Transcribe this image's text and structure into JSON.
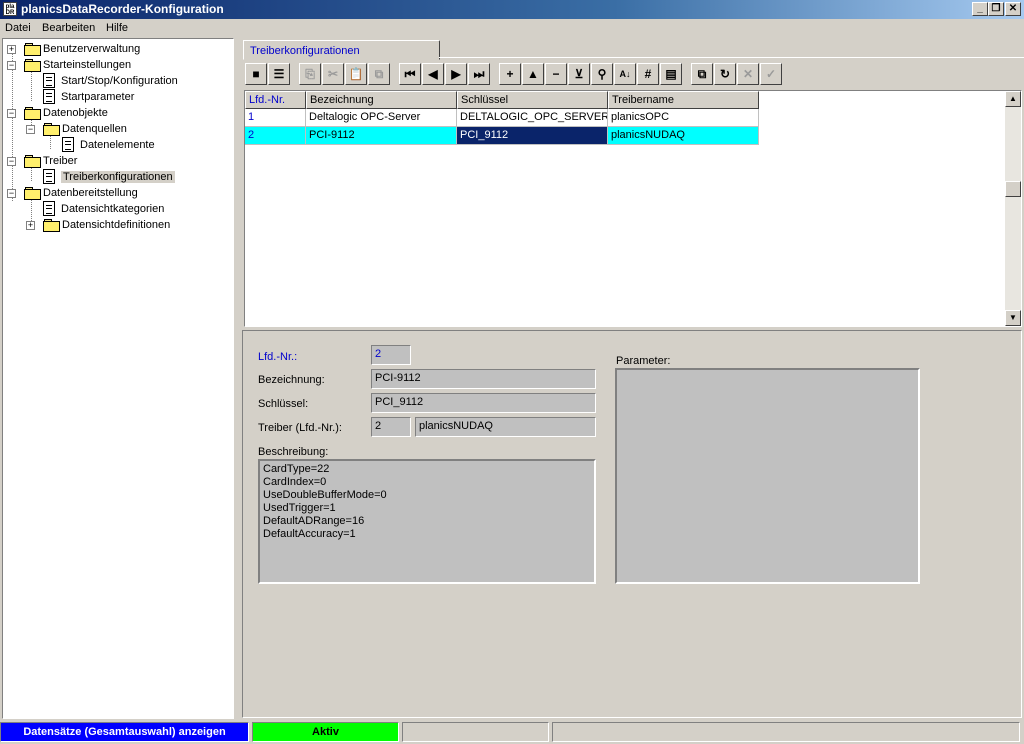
{
  "window": {
    "title": "planicsDataRecorder-Konfiguration",
    "icon_text_top": "pla",
    "icon_text_bottom": "DR",
    "minimize_glyph": "_",
    "maximize_glyph": "❐",
    "close_glyph": "✕"
  },
  "menu": {
    "datei": "Datei",
    "bearbeiten": "Bearbeiten",
    "hilfe": "Hilfe"
  },
  "tree": {
    "items": [
      {
        "label": "Benutzerverwaltung",
        "expander": "+"
      },
      {
        "label": "Starteinstellungen",
        "expander": "−"
      },
      {
        "label": "Start/Stop/Konfiguration"
      },
      {
        "label": "Startparameter"
      },
      {
        "label": "Datenobjekte",
        "expander": "−"
      },
      {
        "label": "Datenquellen",
        "expander": "−"
      },
      {
        "label": "Datenelemente"
      },
      {
        "label": "Treiber",
        "expander": "−"
      },
      {
        "label": "Treiberkonfigurationen",
        "selected": true
      },
      {
        "label": "Datenbereitstellung",
        "expander": "−"
      },
      {
        "label": "Datensichtkategorien"
      },
      {
        "label": "Datensichtdefinitionen",
        "expander": "+"
      }
    ]
  },
  "tab": {
    "label": "Treiberkonfigurationen"
  },
  "toolbar": {
    "buttons": [
      {
        "name": "stop-icon",
        "glyph": "■"
      },
      {
        "name": "list-icon",
        "glyph": "☰"
      },
      {
        "name": "copy-icon",
        "glyph": "⎘",
        "disabled": true
      },
      {
        "name": "cut-icon",
        "glyph": "✂",
        "disabled": true
      },
      {
        "name": "paste-icon",
        "glyph": "📋",
        "disabled": true
      },
      {
        "name": "paste-special-icon",
        "glyph": "⧉",
        "disabled": true
      },
      {
        "name": "first-record-icon",
        "glyph": "⏮"
      },
      {
        "name": "prev-record-icon",
        "glyph": "◀"
      },
      {
        "name": "next-record-icon",
        "glyph": "▶"
      },
      {
        "name": "last-record-icon",
        "glyph": "⏭"
      },
      {
        "name": "add-record-icon",
        "glyph": "+"
      },
      {
        "name": "move-up-icon",
        "glyph": "▲"
      },
      {
        "name": "delete-record-icon",
        "glyph": "−"
      },
      {
        "name": "move-down-icon",
        "glyph": "⊻"
      },
      {
        "name": "search-binoculars-icon",
        "glyph": "⚲"
      },
      {
        "name": "sort-az-icon",
        "glyph": "A↓"
      },
      {
        "name": "number-icon",
        "glyph": "#"
      },
      {
        "name": "report-icon",
        "glyph": "▤"
      },
      {
        "name": "copy-records-icon",
        "glyph": "⧉"
      },
      {
        "name": "refresh-icon",
        "glyph": "↻"
      },
      {
        "name": "cancel-icon",
        "glyph": "✕",
        "disabled": true
      },
      {
        "name": "confirm-icon",
        "glyph": "✓",
        "disabled": true
      }
    ]
  },
  "grid": {
    "columns": [
      "Lfd.-Nr.",
      "Bezeichnung",
      "Schlüssel",
      "Treibername"
    ],
    "rows": [
      [
        "1",
        "Deltalogic OPC-Server",
        "DELTALOGIC_OPC_SERVER",
        "planicsOPC"
      ],
      [
        "2",
        "PCI-9112",
        "PCI_9112",
        "planicsNUDAQ"
      ]
    ],
    "scroll_up": "▲",
    "scroll_down": "▼"
  },
  "detail": {
    "lfd_label": "Lfd.-Nr.:",
    "lfd_value": "2",
    "bezeichnung_label": "Bezeichnung:",
    "bezeichnung_value": "PCI-9112",
    "schluessel_label": "Schlüssel:",
    "schluessel_value": "PCI_9112",
    "treiber_label": "Treiber (Lfd.-Nr.):",
    "treiber_nr": "2",
    "treiber_name": "planicsNUDAQ",
    "beschreibung_label": "Beschreibung:",
    "beschreibung_value": "CardType=22\nCardIndex=0\nUseDoubleBufferMode=0\nUsedTrigger=1\nDefaultADRange=16\nDefaultAccuracy=1",
    "parameter_label": "Parameter:",
    "parameter_value": ""
  },
  "status": {
    "show_records": "Datensätze (Gesamtauswahl) anzeigen",
    "state": "Aktiv",
    "pane3": "",
    "pane4": "",
    "colors": {
      "show_records_bg": "#0000ff",
      "show_records_fg": "#ffffff",
      "state_bg": "#00ff00"
    }
  }
}
